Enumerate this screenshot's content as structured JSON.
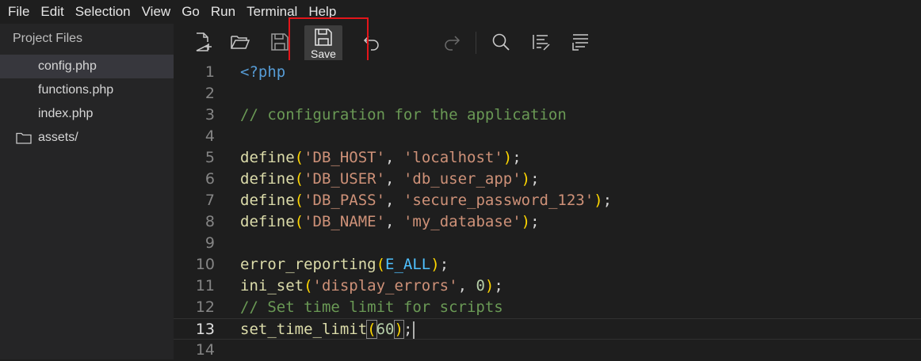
{
  "menu": [
    "File",
    "Edit",
    "Selection",
    "View",
    "Go",
    "Run",
    "Terminal",
    "Help"
  ],
  "sidebar": {
    "title": "Project Files",
    "items": [
      {
        "label": "config.php",
        "active": true,
        "type": "file"
      },
      {
        "label": "functions.php",
        "active": false,
        "type": "file"
      },
      {
        "label": "index.php",
        "active": false,
        "type": "file"
      },
      {
        "label": "assets/",
        "active": false,
        "type": "folder"
      }
    ]
  },
  "toolbar": {
    "buttons": [
      "new-file-icon",
      "open-folder-icon",
      "save-icon",
      "save-icon",
      "undo-icon",
      "redo-icon",
      "search-icon",
      "format-icon",
      "wrap-icon"
    ],
    "save_tooltip": "Save"
  },
  "editor": {
    "current_line": 13,
    "line_numbers": [
      "1",
      "2",
      "3",
      "4",
      "5",
      "6",
      "7",
      "8",
      "9",
      "10",
      "11",
      "12",
      "13",
      "14"
    ],
    "lines": [
      [
        {
          "t": "tag",
          "v": "<?php"
        }
      ],
      [],
      [
        {
          "t": "com",
          "v": "// configuration for the application"
        }
      ],
      [],
      [
        {
          "t": "fn",
          "v": "define"
        },
        {
          "t": "brace",
          "v": "("
        },
        {
          "t": "str",
          "v": "'DB_HOST'"
        },
        {
          "t": "punc",
          "v": ", "
        },
        {
          "t": "str",
          "v": "'localhost'"
        },
        {
          "t": "brace",
          "v": ")"
        },
        {
          "t": "punc",
          "v": ";"
        }
      ],
      [
        {
          "t": "fn",
          "v": "define"
        },
        {
          "t": "brace",
          "v": "("
        },
        {
          "t": "str",
          "v": "'DB_USER'"
        },
        {
          "t": "punc",
          "v": ", "
        },
        {
          "t": "str",
          "v": "'db_user_app'"
        },
        {
          "t": "brace",
          "v": ")"
        },
        {
          "t": "punc",
          "v": ";"
        }
      ],
      [
        {
          "t": "fn",
          "v": "define"
        },
        {
          "t": "brace",
          "v": "("
        },
        {
          "t": "str",
          "v": "'DB_PASS'"
        },
        {
          "t": "punc",
          "v": ", "
        },
        {
          "t": "str",
          "v": "'secure_password_123'"
        },
        {
          "t": "brace",
          "v": ")"
        },
        {
          "t": "punc",
          "v": ";"
        }
      ],
      [
        {
          "t": "fn",
          "v": "define"
        },
        {
          "t": "brace",
          "v": "("
        },
        {
          "t": "str",
          "v": "'DB_NAME'"
        },
        {
          "t": "punc",
          "v": ", "
        },
        {
          "t": "str",
          "v": "'my_database'"
        },
        {
          "t": "brace",
          "v": ")"
        },
        {
          "t": "punc",
          "v": ";"
        }
      ],
      [],
      [
        {
          "t": "fn",
          "v": "error_reporting"
        },
        {
          "t": "brace",
          "v": "("
        },
        {
          "t": "const",
          "v": "E_ALL"
        },
        {
          "t": "brace",
          "v": ")"
        },
        {
          "t": "punc",
          "v": ";"
        }
      ],
      [
        {
          "t": "fn",
          "v": "ini_set"
        },
        {
          "t": "brace",
          "v": "("
        },
        {
          "t": "str",
          "v": "'display_errors'"
        },
        {
          "t": "punc",
          "v": ", "
        },
        {
          "t": "num",
          "v": "0"
        },
        {
          "t": "brace",
          "v": ")"
        },
        {
          "t": "punc",
          "v": ";"
        }
      ],
      [
        {
          "t": "com",
          "v": "// Set time limit for scripts"
        }
      ],
      [
        {
          "t": "fn",
          "v": "set_time_limit"
        },
        {
          "t": "brace",
          "v": "("
        },
        {
          "t": "num",
          "v": "60"
        },
        {
          "t": "brace",
          "v": ")"
        },
        {
          "t": "punc",
          "v": ";"
        }
      ],
      []
    ]
  },
  "colors": {
    "accent_highlight": "#e3151a",
    "background": "#1e1e1e",
    "sidebar_bg": "#252526"
  }
}
